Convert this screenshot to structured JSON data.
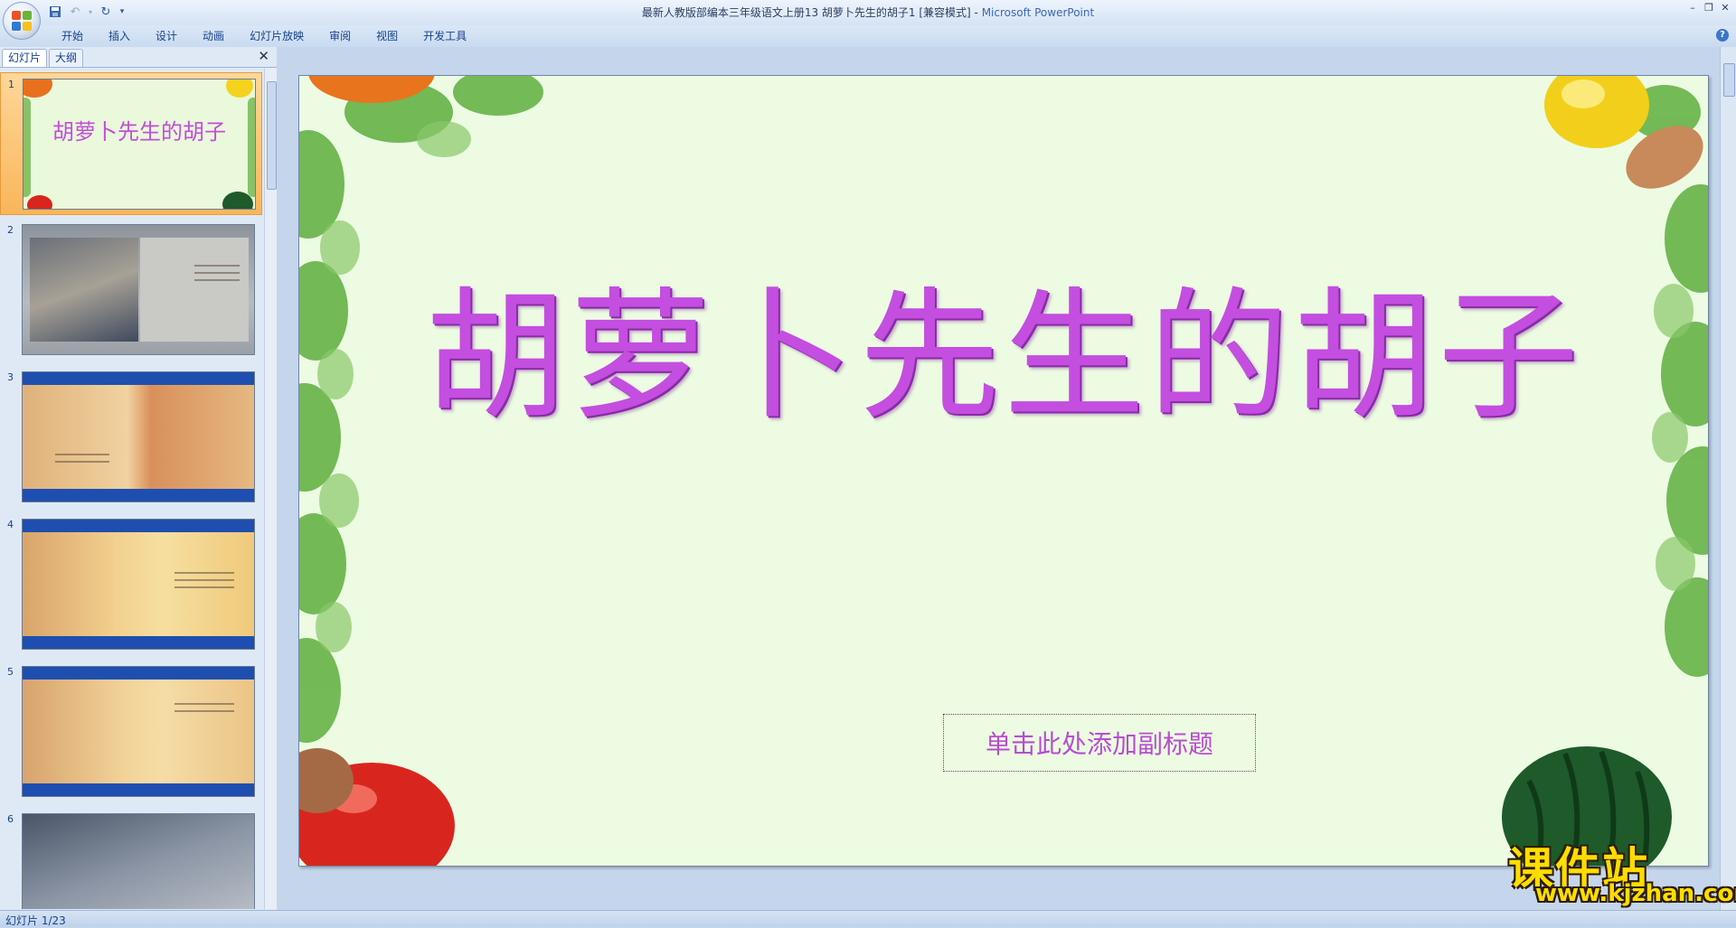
{
  "window": {
    "title_doc": "最新人教版部编本三年级语文上册13 胡萝卜先生的胡子1 [兼容模式]",
    "title_sep": " - ",
    "title_app": "Microsoft PowerPoint"
  },
  "ribbon": {
    "tabs": [
      "开始",
      "插入",
      "设计",
      "动画",
      "幻灯片放映",
      "审阅",
      "视图",
      "开发工具"
    ]
  },
  "left_pane": {
    "tabs": [
      "幻灯片",
      "大纲"
    ],
    "slides": [
      {
        "number": "1",
        "title": "胡萝卜先生的胡子"
      },
      {
        "number": "2"
      },
      {
        "number": "3"
      },
      {
        "number": "4"
      },
      {
        "number": "5"
      },
      {
        "number": "6"
      }
    ]
  },
  "slide": {
    "title": "胡萝卜先生的胡子",
    "subtitle_placeholder": "单击此处添加副标题"
  },
  "status": {
    "slide_counter": "幻灯片 1/23"
  },
  "watermark": {
    "name": "课件站",
    "url": "www.kjzhan.com"
  },
  "colors": {
    "title_purple": "#c44ee0",
    "slide_bg": "#ecfbe2",
    "watermark_yellow": "#ffdd00"
  }
}
